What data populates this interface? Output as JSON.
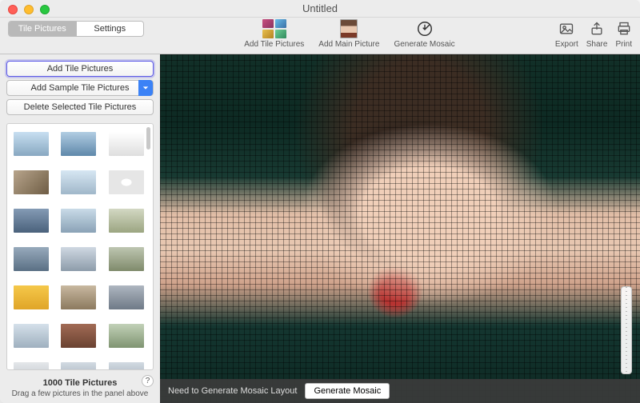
{
  "window": {
    "title": "Untitled"
  },
  "toolbar": {
    "tabs": {
      "tile_pictures": "Tile Pictures",
      "settings": "Settings",
      "active": "tile_pictures"
    },
    "center": {
      "add_tile": "Add Tile Pictures",
      "add_main": "Add Main Picture",
      "generate": "Generate Mosaic"
    },
    "right": {
      "export": "Export",
      "share": "Share",
      "print": "Print"
    }
  },
  "sidebar": {
    "add_tile_btn": "Add Tile Pictures",
    "add_sample_btn": "Add Sample Tile Pictures",
    "delete_btn": "Delete Selected Tile Pictures",
    "count_label": "1000 Tile Pictures",
    "hint": "Drag a few pictures in the panel above",
    "help": "?",
    "thumbs": [
      "linear-gradient(180deg,#c7dff1,#88a8c1)",
      "linear-gradient(180deg,#b1cde3,#5f88aa)",
      "linear-gradient(180deg,#ffffff,#dedede)",
      "linear-gradient(135deg,#b8a58c,#6e5c44)",
      "linear-gradient(180deg,#d7e7f3,#a0b7c9)",
      "radial-gradient(#fff 20%, #e6e6e6 22%)",
      "linear-gradient(180deg,#849bb5,#4a617b)",
      "linear-gradient(180deg,#c9dbe8,#8aa2b6)",
      "linear-gradient(180deg,#d3d8c3,#9ba581)",
      "linear-gradient(180deg,#97aabc,#5a6f84)",
      "linear-gradient(180deg,#cfd8e2,#8d9caa)",
      "linear-gradient(180deg,#bec6b1,#7f8a6b)",
      "linear-gradient(180deg,#f5c84a,#e0a528)",
      "linear-gradient(180deg,#c8b8a0,#8c7a5f)",
      "linear-gradient(180deg,#aeb6c0,#6f7a87)",
      "linear-gradient(180deg,#d5e0ea,#9fb0bf)",
      "linear-gradient(180deg,#a26b55,#6a4231)",
      "linear-gradient(180deg,#c2d1b8,#7f9471)",
      "linear-gradient(180deg,#e4e7ea,#b7bdc4)",
      "linear-gradient(180deg,#d2dae2,#97a3af)",
      "linear-gradient(180deg,#d2dae2,#97a3af)"
    ]
  },
  "statusbar": {
    "message": "Need to Generate Mosaic Layout",
    "generate_btn": "Generate Mosaic"
  }
}
